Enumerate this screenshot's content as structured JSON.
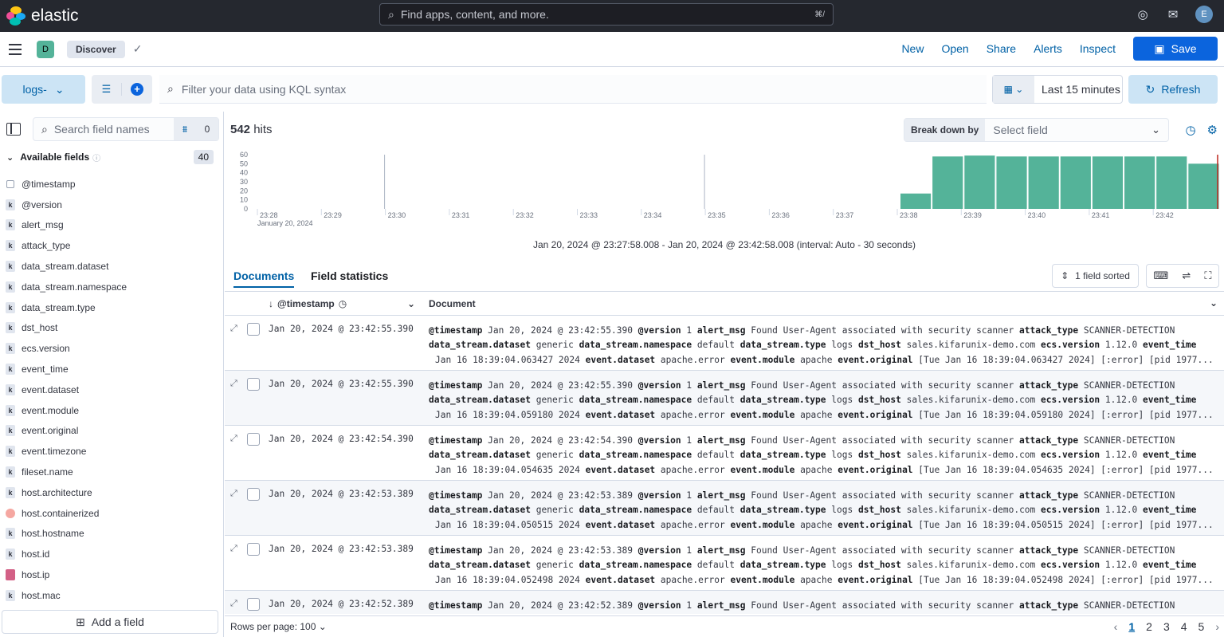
{
  "topbar": {
    "brand": "elastic",
    "search_placeholder": "Find apps, content, and more.",
    "search_shortcut": "⌘/",
    "user_initial": "E"
  },
  "appbar": {
    "space_initial": "D",
    "breadcrumb": "Discover",
    "links": [
      "New",
      "Open",
      "Share",
      "Alerts",
      "Inspect"
    ],
    "save_label": "Save"
  },
  "query": {
    "data_view": "logs-",
    "kql_placeholder": "Filter your data using KQL syntax",
    "time_range": "Last 15 minutes",
    "refresh_label": "Refresh"
  },
  "sidebar": {
    "search_placeholder": "Search field names",
    "filter_count": "0",
    "available_label": "Available fields",
    "available_count": "40",
    "fields": [
      {
        "name": "@timestamp",
        "type": "date"
      },
      {
        "name": "@version",
        "type": "k"
      },
      {
        "name": "alert_msg",
        "type": "k"
      },
      {
        "name": "attack_type",
        "type": "k"
      },
      {
        "name": "data_stream.dataset",
        "type": "k"
      },
      {
        "name": "data_stream.namespace",
        "type": "k"
      },
      {
        "name": "data_stream.type",
        "type": "k"
      },
      {
        "name": "dst_host",
        "type": "k"
      },
      {
        "name": "ecs.version",
        "type": "k"
      },
      {
        "name": "event_time",
        "type": "k"
      },
      {
        "name": "event.dataset",
        "type": "k"
      },
      {
        "name": "event.module",
        "type": "k"
      },
      {
        "name": "event.original",
        "type": "k"
      },
      {
        "name": "event.timezone",
        "type": "k"
      },
      {
        "name": "fileset.name",
        "type": "k"
      },
      {
        "name": "host.architecture",
        "type": "k"
      },
      {
        "name": "host.containerized",
        "type": "bool"
      },
      {
        "name": "host.hostname",
        "type": "k"
      },
      {
        "name": "host.id",
        "type": "k"
      },
      {
        "name": "host.ip",
        "type": "ip"
      },
      {
        "name": "host.mac",
        "type": "k"
      }
    ],
    "add_field_label": "Add a field"
  },
  "results": {
    "hits_count": "542",
    "hits_label": "hits",
    "breakdown_label": "Break down by",
    "breakdown_placeholder": "Select field",
    "interval_text": "Jan 20, 2024 @ 23:27:58.008 - Jan 20, 2024 @ 23:42:58.008 (interval: Auto - 30 seconds)",
    "tabs": [
      "Documents",
      "Field statistics"
    ],
    "sorted_label": "1 field sorted",
    "col_timestamp": "@timestamp",
    "col_document": "Document",
    "rows_per_page": "Rows per page: 100",
    "pages": [
      "1",
      "2",
      "3",
      "4",
      "5"
    ]
  },
  "chart_data": {
    "type": "bar",
    "x": [
      "23:38:00",
      "23:38:30",
      "23:39:00",
      "23:39:30",
      "23:40:00",
      "23:40:30",
      "23:41:00",
      "23:41:30",
      "23:42:00",
      "23:42:30"
    ],
    "values": [
      17,
      58,
      59,
      58,
      58,
      58,
      58,
      58,
      58,
      50
    ],
    "ylim": [
      0,
      60
    ],
    "yticks": [
      "60",
      "50",
      "40",
      "30",
      "20",
      "10",
      "0"
    ],
    "xticks": [
      "23:28",
      "23:29",
      "23:30",
      "23:31",
      "23:32",
      "23:33",
      "23:34",
      "23:35",
      "23:36",
      "23:37",
      "23:38",
      "23:39",
      "23:40",
      "23:41",
      "23:42"
    ],
    "xsub": "January 20, 2024",
    "bar_color": "#54b399"
  },
  "documents": [
    {
      "ts": "Jan 20, 2024 @ 23:42:55.390",
      "version": "1",
      "event_time": "Jan 16 18:39:04.063427 2024",
      "original": "[Tue Jan 16 18:39:04.063427 2024] [:error] [pid 1977..."
    },
    {
      "ts": "Jan 20, 2024 @ 23:42:55.390",
      "version": "1",
      "event_time": "Jan 16 18:39:04.059180 2024",
      "original": "[Tue Jan 16 18:39:04.059180 2024] [:error] [pid 1977..."
    },
    {
      "ts": "Jan 20, 2024 @ 23:42:54.390",
      "version": "1",
      "event_time": "Jan 16 18:39:04.054635 2024",
      "original": "[Tue Jan 16 18:39:04.054635 2024] [:error] [pid 1977..."
    },
    {
      "ts": "Jan 20, 2024 @ 23:42:53.389",
      "version": "1",
      "event_time": "Jan 16 18:39:04.050515 2024",
      "original": "[Tue Jan 16 18:39:04.050515 2024] [:error] [pid 1977..."
    },
    {
      "ts": "Jan 20, 2024 @ 23:42:53.389",
      "version": "1",
      "event_time": "Jan 16 18:39:04.052498 2024",
      "original": "[Tue Jan 16 18:39:04.052498 2024] [:error] [pid 1977..."
    },
    {
      "ts": "Jan 20, 2024 @ 23:42:52.389",
      "version": "1",
      "event_time": "",
      "original": ""
    }
  ],
  "doc_common": {
    "k_timestamp": "@timestamp",
    "k_version": "@version",
    "k_alert": "alert_msg",
    "alert": "Found User-Agent associated with security scanner",
    "k_attack": "attack_type",
    "attack": "SCANNER-DETECTION",
    "k_dsd": "data_stream.dataset",
    "dsd": "generic",
    "k_dsn": "data_stream.namespace",
    "dsn": "default",
    "k_dst": "data_stream.type",
    "dst": "logs",
    "k_host": "dst_host",
    "host": "sales.kifarunix-demo.com",
    "k_ecs": "ecs.version",
    "ecs": "1.12.0",
    "k_etime": "event_time",
    "k_edataset": "event.dataset",
    "edataset": "apache.error",
    "k_emodule": "event.module",
    "emodule": "apache",
    "k_eorig": "event.original"
  }
}
